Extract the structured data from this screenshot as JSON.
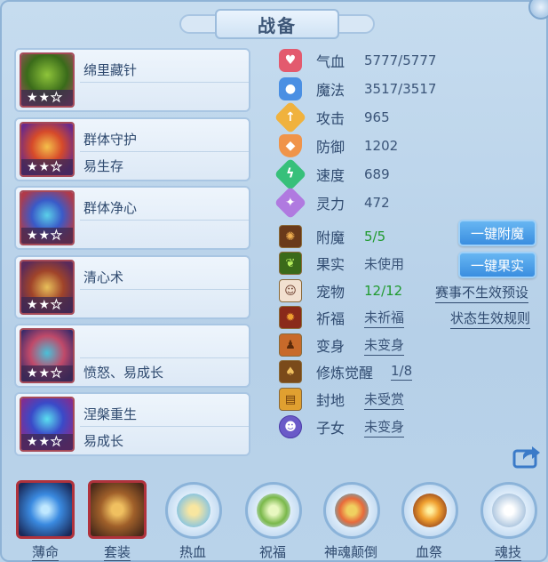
{
  "title": "战备",
  "skills": [
    {
      "name": "绵里藏针",
      "sub": "",
      "stars_filled": 2,
      "stars_total": 3
    },
    {
      "name": "群体守护",
      "sub": "易生存",
      "stars_filled": 2,
      "stars_total": 3
    },
    {
      "name": "群体净心",
      "sub": "",
      "stars_filled": 2,
      "stars_total": 3
    },
    {
      "name": "清心术",
      "sub": "",
      "stars_filled": 2,
      "stars_total": 3
    },
    {
      "name": "",
      "sub": "愤怒、易成长",
      "stars_filled": 2,
      "stars_total": 3
    },
    {
      "name": "涅槃重生",
      "sub": "易成长",
      "stars_filled": 2,
      "stars_total": 3
    }
  ],
  "stats": [
    {
      "label": "气血",
      "value": "5777/5777",
      "icon": "heart-icon",
      "color": "#e35a6e"
    },
    {
      "label": "魔法",
      "value": "3517/3517",
      "icon": "mana-icon",
      "color": "#4a8fe3"
    },
    {
      "label": "攻击",
      "value": "965",
      "icon": "attack-icon",
      "color": "#f0b23e"
    },
    {
      "label": "防御",
      "value": "1202",
      "icon": "defense-icon",
      "color": "#f0944a"
    },
    {
      "label": "速度",
      "value": "689",
      "icon": "speed-icon",
      "color": "#37c07a"
    },
    {
      "label": "灵力",
      "value": "472",
      "icon": "spirit-icon",
      "color": "#b07ae0"
    }
  ],
  "attrs": [
    {
      "label": "附魔",
      "value": "5/5",
      "style": "green",
      "icon": "enchant-icon"
    },
    {
      "label": "果实",
      "value": "未使用",
      "style": "plain",
      "icon": "fruit-icon"
    },
    {
      "label": "宠物",
      "value": "12/12",
      "style": "green",
      "icon": "pet-icon"
    },
    {
      "label": "祈福",
      "value": "未祈福",
      "style": "underline",
      "icon": "blessing-icon"
    },
    {
      "label": "变身",
      "value": "未变身",
      "style": "underline",
      "icon": "transform-icon"
    },
    {
      "label": "修炼觉醒",
      "value": "1/8",
      "style": "underline",
      "icon": "cultivation-icon"
    },
    {
      "label": "封地",
      "value": "未受赏",
      "style": "underline",
      "icon": "fief-icon"
    },
    {
      "label": "子女",
      "value": "未变身",
      "style": "underline",
      "icon": "child-icon"
    }
  ],
  "buttons": {
    "enchant_all": "一键附魔",
    "fruit_all": "一键果实"
  },
  "links": {
    "no_preset": "赛事不生效预设",
    "status_rules": "状态生效规则"
  },
  "bottom_tabs": [
    {
      "label": "薄命",
      "icon": "star-orb-icon",
      "frame": "square",
      "underline": true
    },
    {
      "label": "套装",
      "icon": "armor-set-icon",
      "frame": "square",
      "underline": true
    },
    {
      "label": "热血",
      "icon": "hot-blood-icon",
      "frame": "round",
      "underline": false
    },
    {
      "label": "祝福",
      "icon": "blessing-leaf-icon",
      "frame": "round",
      "underline": false
    },
    {
      "label": "神魂颠倒",
      "icon": "soul-icon",
      "frame": "round",
      "underline": false
    },
    {
      "label": "血祭",
      "icon": "blood-sacrifice-icon",
      "frame": "round",
      "underline": false
    },
    {
      "label": "魂技",
      "icon": "soul-skill-icon",
      "frame": "round",
      "underline": true
    }
  ]
}
